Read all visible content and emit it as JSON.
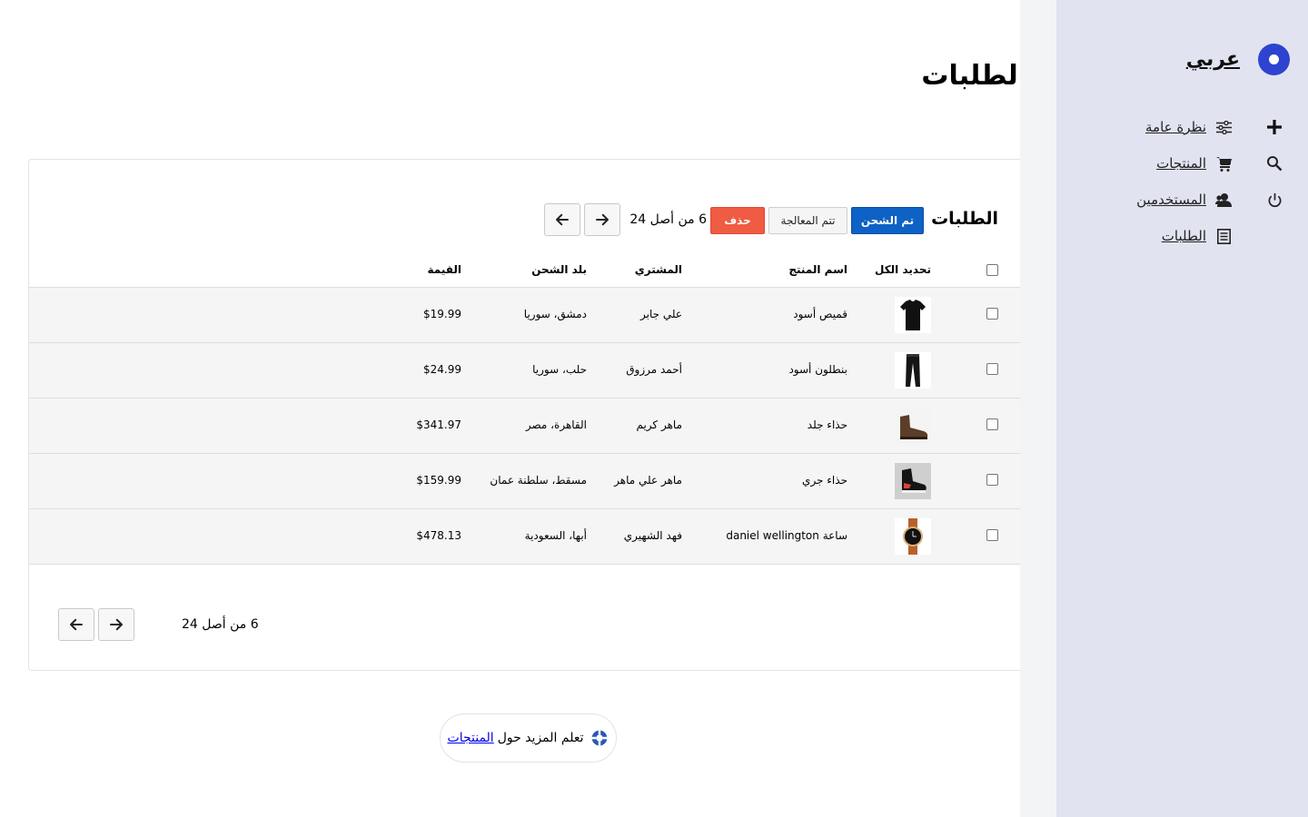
{
  "brand": {
    "name": "عربي"
  },
  "page": {
    "title": "الطلبات"
  },
  "nav": {
    "items": [
      {
        "label": "نظرة عامة",
        "icon": "sliders-icon"
      },
      {
        "label": "المنتجات",
        "icon": "cart-icon"
      },
      {
        "label": "المستخدمين",
        "icon": "users-icon"
      },
      {
        "label": "الطلبات",
        "icon": "document-icon"
      }
    ],
    "actions": [
      "plus-icon",
      "search-icon",
      "power-icon"
    ]
  },
  "card": {
    "heading": "الطلبات",
    "shipped_label": "تم الشحن",
    "processing_label": "تتم المعالجة",
    "delete_label": "حذف",
    "count_label": "6 من أصل 24"
  },
  "table": {
    "headers": {
      "select_all": "تحديد الكل",
      "product": "اسم المنتج",
      "buyer": "المشتري",
      "country": "بلد الشحن",
      "value": "القيمة"
    },
    "rows": [
      {
        "product": "قميص أسود",
        "buyer": "علي جابر",
        "country": "دمشق، سوريا",
        "value": "$19.99",
        "thumb": "tshirt"
      },
      {
        "product": "بنطلون أسود",
        "buyer": "أحمد مرزوق",
        "country": "حلب، سوريا",
        "value": "$24.99",
        "thumb": "pants"
      },
      {
        "product": "حذاء جلد",
        "buyer": "ماهر كريم",
        "country": "القاهرة، مصر",
        "value": "$341.97",
        "thumb": "boot"
      },
      {
        "product": "حذاء جري",
        "buyer": "ماهر علي ماهر",
        "country": "مسقط، سلطنة عمان",
        "value": "$159.99",
        "thumb": "sneaker"
      },
      {
        "product": "ساعة daniel wellington",
        "buyer": "فهد الشهيري",
        "country": "أبها، السعودية",
        "value": "$478.13",
        "thumb": "watch"
      }
    ]
  },
  "footer": {
    "count_label": "6 من أصل 24"
  },
  "help": {
    "text": "تعلم المزيد حول",
    "link": "المنتجات"
  },
  "colors": {
    "sidebar_bg": "#e1e3f0",
    "primary": "#0e62c6",
    "danger": "#ef5b43",
    "brand": "#2e43d0"
  }
}
